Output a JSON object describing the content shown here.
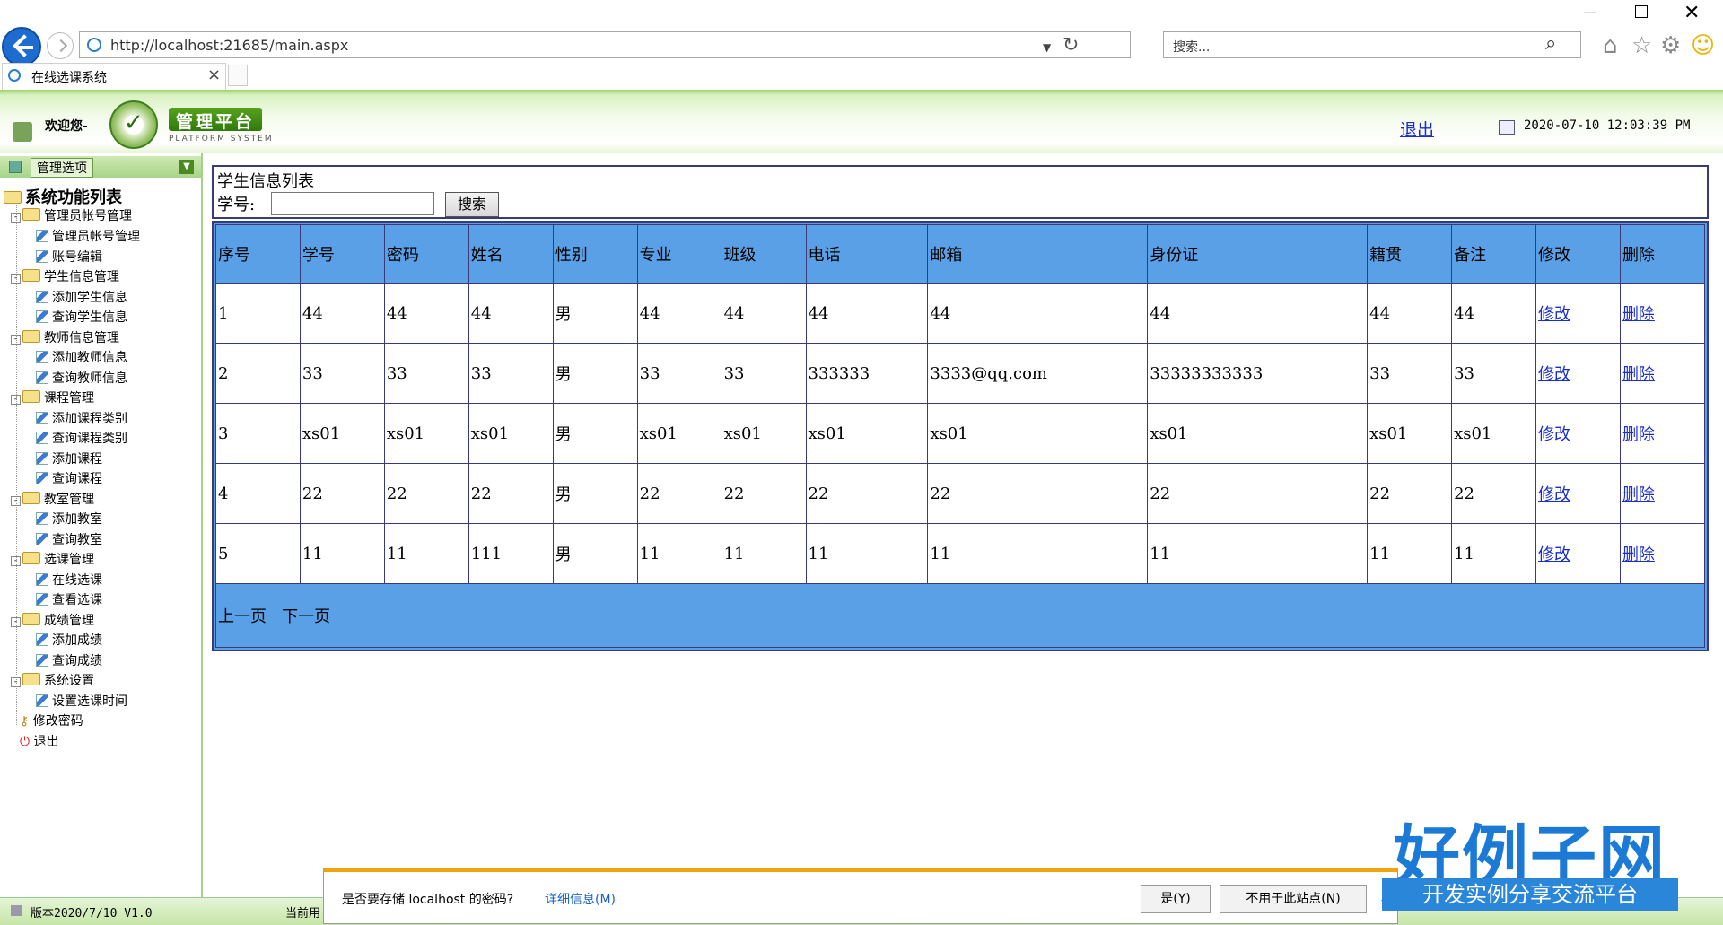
{
  "browser": {
    "url": "http://localhost:21685/main.aspx",
    "search_placeholder": "搜索...",
    "tab_title": "在线选课系统"
  },
  "header": {
    "welcome": "欢迎您-",
    "logo_title": "管理平台",
    "logo_subtitle": "PLATFORM SYSTEM",
    "logout": "退出",
    "datetime": "2020-07-10 12:03:39 PM"
  },
  "sidebar": {
    "header_label": "管理选项",
    "root": "系统功能列表",
    "groups": [
      {
        "label": "管理员帐号管理",
        "items": [
          "管理员帐号管理",
          "账号编辑"
        ]
      },
      {
        "label": "学生信息管理",
        "items": [
          "添加学生信息",
          "查询学生信息"
        ]
      },
      {
        "label": "教师信息管理",
        "items": [
          "添加教师信息",
          "查询教师信息"
        ]
      },
      {
        "label": "课程管理",
        "items": [
          "添加课程类别",
          "查询课程类别",
          "添加课程",
          "查询课程"
        ]
      },
      {
        "label": "教室管理",
        "items": [
          "添加教室",
          "查询教室"
        ]
      },
      {
        "label": "选课管理",
        "items": [
          "在线选课",
          "查看选课"
        ]
      },
      {
        "label": "成绩管理",
        "items": [
          "添加成绩",
          "查询成绩"
        ]
      },
      {
        "label": "系统设置",
        "items": [
          "设置选课时间"
        ]
      }
    ],
    "change_password": "修改密码",
    "exit": "退出"
  },
  "main": {
    "list_title": "学生信息列表",
    "sno_label": "学号:",
    "search_button": "搜索",
    "columns": [
      "序号",
      "学号",
      "密码",
      "姓名",
      "性别",
      "专业",
      "班级",
      "电话",
      "邮箱",
      "身份证",
      "籍贯",
      "备注",
      "修改",
      "删除"
    ],
    "rows": [
      [
        "1",
        "44",
        "44",
        "44",
        "男",
        "44",
        "44",
        "44",
        "44",
        "44",
        "44",
        "44",
        "修改",
        "删除"
      ],
      [
        "2",
        "33",
        "33",
        "33",
        "男",
        "33",
        "33",
        "333333",
        "3333@qq.com",
        "33333333333",
        "33",
        "33",
        "修改",
        "删除"
      ],
      [
        "3",
        "xs01",
        "xs01",
        "xs01",
        "男",
        "xs01",
        "xs01",
        "xs01",
        "xs01",
        "xs01",
        "xs01",
        "xs01",
        "修改",
        "删除"
      ],
      [
        "4",
        "22",
        "22",
        "22",
        "男",
        "22",
        "22",
        "22",
        "22",
        "22",
        "22",
        "22",
        "修改",
        "删除"
      ],
      [
        "5",
        "11",
        "11",
        "111",
        "男",
        "11",
        "11",
        "11",
        "11",
        "11",
        "11",
        "11",
        "修改",
        "删除"
      ]
    ],
    "pager": {
      "prev": "上一页",
      "next": "下一页"
    }
  },
  "statusbar": {
    "version": "版本2020/7/10 V1.0",
    "current_user": "当前用"
  },
  "password_bar": {
    "question": "是否要存储 localhost 的密码?",
    "details": "详细信息(M)",
    "yes": "是(Y)",
    "never": "不用于此站点(N)",
    "close": "×"
  },
  "badge": {
    "title": "好例子网",
    "subtitle": "开发实例分享交流平台"
  },
  "colors": {
    "table_header_bg": "#5aa0e6",
    "link": "#1a2dd0",
    "border": "#3a3a7a",
    "brand_green": "#4a8a22"
  }
}
